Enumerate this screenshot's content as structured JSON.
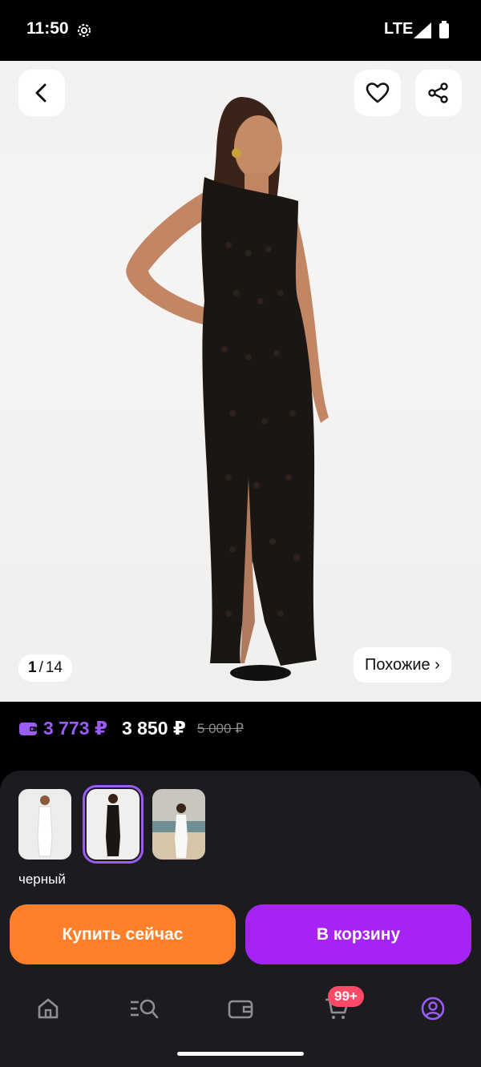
{
  "status_bar": {
    "time": "11:50",
    "network": "LTE"
  },
  "gallery": {
    "current": "1",
    "separator": "/",
    "total": "14",
    "similar_label": "Похожие ›"
  },
  "price": {
    "wallet_price": "3 773 ₽",
    "price": "3 850 ₽",
    "old_price": "5 000 ₽"
  },
  "variants": {
    "selected_color": "черный",
    "count": 3,
    "selected_index": 1
  },
  "actions": {
    "buy_now": "Купить сейчас",
    "add_to_cart": "В корзину"
  },
  "nav": {
    "cart_badge": "99+"
  },
  "colors": {
    "accent_purple": "#9b5cf6",
    "buy_orange": "#ff7f2a",
    "cart_purple": "#a523f5",
    "badge_red": "#ff4a67"
  }
}
